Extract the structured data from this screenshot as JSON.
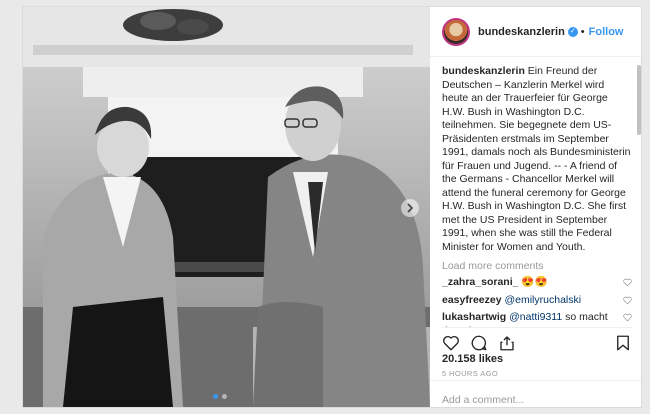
{
  "post": {
    "username": "bundeskanzlerin",
    "follow_label": "Follow",
    "caption_text": "Ein Freund der Deutschen – Kanzlerin Merkel wird heute an der Trauerfeier für George H.W. Bush in Washington D.C. teilnehmen. Sie begegnete dem US-Präsidenten erstmals im September 1991, damals noch als Bundesministerin für Frauen und Jugend. -- - A friend of the Germans - Chancellor Merkel will attend the funeral ceremony for George H.W. Bush in Washington D.C. She first met the US President in September 1991, when she was still the Federal Minister for Women and Youth.",
    "load_more": "Load more comments",
    "comments": [
      {
        "user": "_zahra_sorani_",
        "text": "😍😍"
      },
      {
        "user": "easyfreezey",
        "mention": "@emilyruchalski",
        "text": ""
      },
      {
        "user": "lukashartwig",
        "mention": "@natti9311",
        "text": " so macht das Sinn"
      }
    ],
    "likes": "20.158 likes",
    "time_ago": "5 HOURS AGO",
    "add_comment_placeholder": "Add a comment..."
  },
  "icons": {
    "like": "heart-icon",
    "comment": "comment-icon",
    "share": "share-icon",
    "save": "bookmark-icon",
    "next": "chevron-right-icon",
    "verified": "verified-badge-icon"
  },
  "colors": {
    "link": "#3897f0",
    "text": "#262626",
    "muted": "#999999"
  }
}
